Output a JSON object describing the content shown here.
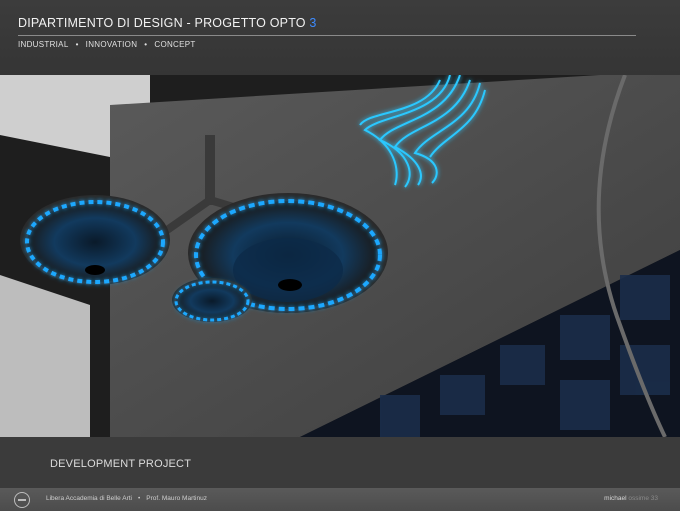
{
  "header": {
    "title_main": "DIPARTIMENTO DI DESIGN  -  PROGETTO OPTO ",
    "title_accent": "3",
    "subnav": [
      "INDUSTRIAL",
      "INNOVATION",
      "CONCEPT"
    ],
    "subnav_separator": "•"
  },
  "hero": {
    "image_subject": "rendered-lamps-image"
  },
  "caption": {
    "text": "DEVELOPMENT PROJECT"
  },
  "footer": {
    "institution": "Libera Accademia di Belle Arti",
    "separator": "•",
    "professor": "Prof. Mauro Martinuz",
    "credit_name": "michael",
    "credit_dim": "ossime 33"
  },
  "colors": {
    "accent": "#3d8bff",
    "glow": "#1ea8ff"
  }
}
